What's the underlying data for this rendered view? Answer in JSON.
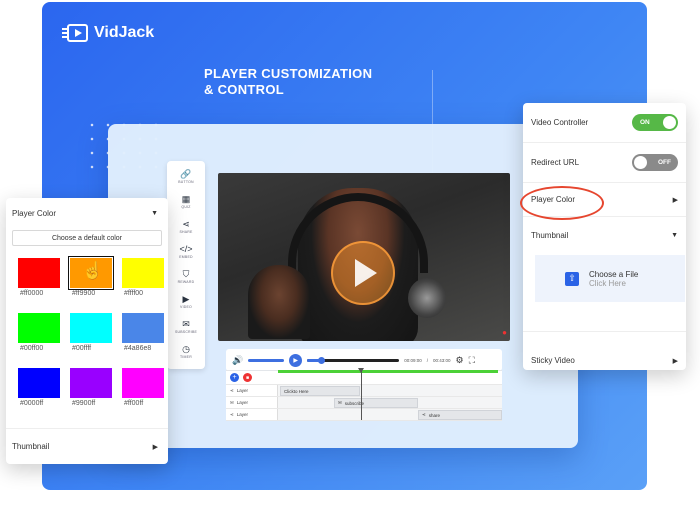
{
  "brand": {
    "name": "VidJack"
  },
  "headline": {
    "line1": "PLAYER CUSTOMIZATION",
    "line2": "& CONTROL"
  },
  "tools": [
    {
      "icon": "link-icon",
      "glyph": "🔗",
      "label": "BUTTON"
    },
    {
      "icon": "calendar-icon",
      "glyph": "▦",
      "label": "QUIZ"
    },
    {
      "icon": "share-icon",
      "glyph": "⋖",
      "label": "SHARE"
    },
    {
      "icon": "code-icon",
      "glyph": "</>",
      "label": "EMBED"
    },
    {
      "icon": "reward-icon",
      "glyph": "⛉",
      "label": "REWARD"
    },
    {
      "icon": "video-icon",
      "glyph": "▶",
      "label": "VIDEO"
    },
    {
      "icon": "mail-icon",
      "glyph": "✉",
      "label": "SUBSCRIBE"
    },
    {
      "icon": "timer-icon",
      "glyph": "◷",
      "label": "TIMER"
    }
  ],
  "player": {
    "time_current": "00:09:00",
    "time_separator": "/",
    "time_total": "00:43:00",
    "progress": 0.15
  },
  "timeline": {
    "rows": [
      {
        "label": "Layer",
        "icon": "share-icon",
        "clip_text": "Clickto Here"
      },
      {
        "label": "Layer",
        "icon": "mail-icon",
        "clip_text": "subscribe"
      },
      {
        "label": "Layer",
        "icon": "share-icon",
        "clip_text": "share"
      }
    ]
  },
  "left_panel": {
    "title": "Player Color",
    "default_button": "Choose a default color",
    "swatches": [
      {
        "hex": "#ff0000",
        "label": "#ff0000"
      },
      {
        "hex": "#ff9900",
        "label": "#ff9900"
      },
      {
        "hex": "#ffff00",
        "label": "#ffff00"
      },
      {
        "hex": "#00ff00",
        "label": "#00ff00"
      },
      {
        "hex": "#00ffff",
        "label": "#00ffff"
      },
      {
        "hex": "#4a86e8",
        "label": "#4a86e8"
      },
      {
        "hex": "#0000ff",
        "label": "#0000ff"
      },
      {
        "hex": "#9900ff",
        "label": "#9900ff"
      },
      {
        "hex": "#ff00ff",
        "label": "#ff00ff"
      }
    ],
    "selected_index": 1,
    "footer": "Thumbnail"
  },
  "right_panel": {
    "video_controller": {
      "label": "Video Controller",
      "state": "ON"
    },
    "redirect_url": {
      "label": "Redirect URL",
      "state": "OFF"
    },
    "player_color": "Player Color",
    "thumbnail": "Thumbnail",
    "upload": {
      "title": "Choose a File",
      "hint": "Click Here"
    },
    "sticky_video": "Sticky Video"
  },
  "colors": {
    "accent": "#2b63e6",
    "on": "#56b847",
    "off": "#8a8a8a",
    "highlight": "#e6462f"
  }
}
